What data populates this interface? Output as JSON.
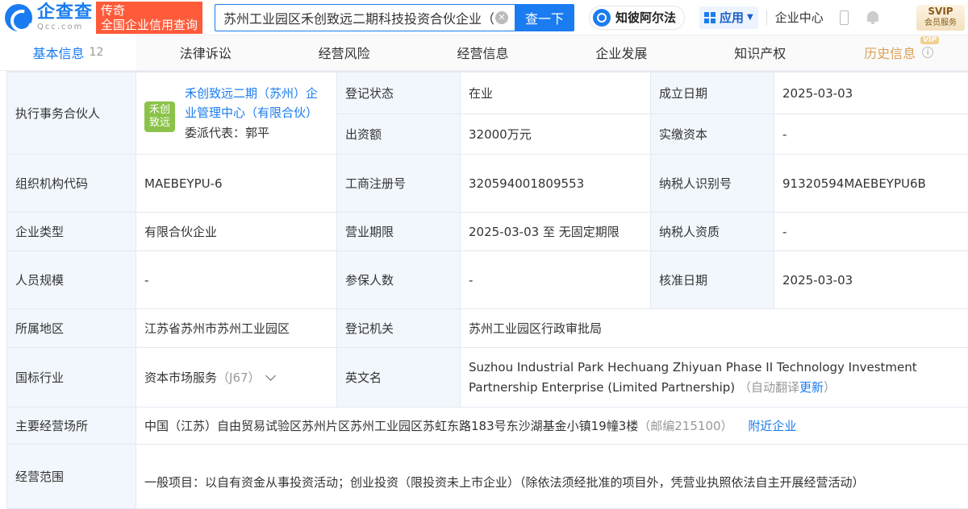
{
  "header": {
    "logo_cn": "企查查",
    "logo_en": "Qcc.com",
    "slogan_line1": "传奇",
    "slogan_line2": "全国企业信用查询",
    "search_value": "苏州工业园区禾创致远二期科技投资合伙企业（",
    "search_button": "查一下",
    "brand_pill": "知彼阿尔法",
    "apps_label": "应用",
    "center_link": "企业中心",
    "svip_top": "SVIP",
    "svip_bottom": "会员服务"
  },
  "tabs": [
    {
      "label": "基本信息",
      "count": "12"
    },
    {
      "label": "法律诉讼"
    },
    {
      "label": "经营风险"
    },
    {
      "label": "经营信息"
    },
    {
      "label": "企业发展"
    },
    {
      "label": "知识产权"
    },
    {
      "label": "历史信息",
      "badge": "VIP"
    }
  ],
  "info": {
    "partner_label": "执行事务合伙人",
    "partner_logo": "禾创致远",
    "partner_name": "禾创致远二期（苏州）企业管理中心（有限合伙）",
    "partner_rep": "委派代表：郭平",
    "reg_status_label": "登记状态",
    "reg_status": "在业",
    "founded_label": "成立日期",
    "founded": "2025-03-03",
    "capital_label": "出资额",
    "capital": "32000万元",
    "paid_label": "实缴资本",
    "paid": "-",
    "org_code_label": "组织机构代码",
    "org_code": "MAEBEYPU-6",
    "biz_reg_label": "工商注册号",
    "biz_reg": "320594001809553",
    "tax_id_label": "纳税人识别号",
    "tax_id": "91320594MAEBEYPU6B",
    "type_label": "企业类型",
    "type": "有限合伙企业",
    "term_label": "营业期限",
    "term": "2025-03-03 至 无固定期限",
    "tax_qual_label": "纳税人资质",
    "tax_qual": "-",
    "staff_label": "人员规模",
    "staff": "-",
    "insured_label": "参保人数",
    "insured": "-",
    "approval_label": "核准日期",
    "approval": "2025-03-03",
    "region_label": "所属地区",
    "region": "江苏省苏州市苏州工业园区",
    "authority_label": "登记机关",
    "authority": "苏州工业园区行政审批局",
    "industry_label": "国标行业",
    "industry": "资本市场服务",
    "industry_code": "（J67）",
    "en_name_label": "英文名",
    "en_name": "Suzhou Industrial Park Hechuang Zhiyuan Phase II Technology Investment Partnership Enterprise (Limited Partnership)",
    "auto_translate": "（自动翻译",
    "update_link": "更新",
    "close_paren": "）",
    "address_label": "主要经营场所",
    "address": "中国（江苏）自由贸易试验区苏州片区苏州工业园区苏虹东路183号东沙湖基金小镇19幢3楼",
    "postcode": "（邮编215100）",
    "nearby_link": "附近企业",
    "scope_label": "经营范围",
    "scope": "一般项目：以自有资金从事投资活动；创业投资（限投资未上市企业）（除依法须经批准的项目外，凭营业执照依法自主开展经营活动）"
  }
}
